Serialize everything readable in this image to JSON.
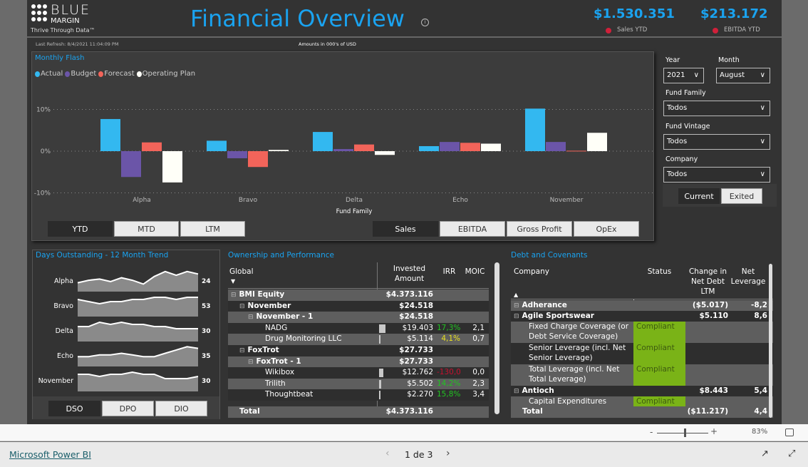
{
  "header": {
    "logo_line1": "BLUE",
    "logo_line2": "MARGIN",
    "logo_tag": "Thrive Through Data™",
    "title": "Financial Overview",
    "last_refresh": "Last Refresh: 8/4/2021 11:04:09 PM",
    "amounts_note": "Amounts in 000's of USD",
    "kpis": [
      {
        "value": "$1.530.351",
        "label": "Sales YTD",
        "status_color": "#d0203a"
      },
      {
        "value": "$213.172",
        "label": "EBITDA YTD",
        "status_color": "#d0203a"
      }
    ]
  },
  "monthly_flash": {
    "title": "Monthly Flash",
    "period_buttons": [
      {
        "label": "YTD",
        "selected": true
      },
      {
        "label": "MTD",
        "selected": false
      },
      {
        "label": "LTM",
        "selected": false
      }
    ],
    "metric_buttons": [
      {
        "label": "Sales",
        "selected": true
      },
      {
        "label": "EBITDA",
        "selected": false
      },
      {
        "label": "Gross Profit",
        "selected": false
      },
      {
        "label": "OpEx",
        "selected": false
      }
    ]
  },
  "chart_data": {
    "type": "bar",
    "title": "",
    "xlabel": "Fund Family",
    "ylabel": "",
    "categories": [
      "Alpha",
      "Bravo",
      "Delta",
      "Echo",
      "November"
    ],
    "ylim": [
      -10,
      10
    ],
    "yticks": [
      "10%",
      "0%",
      "-10%"
    ],
    "ytick_values": [
      10,
      0,
      -10
    ],
    "grid": true,
    "legend_position": "top-left",
    "series": [
      {
        "name": "Actual",
        "color": "#33b8f0",
        "values": [
          7.7,
          2.5,
          4.6,
          1.2,
          10.2
        ]
      },
      {
        "name": "Budget",
        "color": "#6b55a8",
        "values": [
          -6.2,
          -1.7,
          0.5,
          2.2,
          2.2
        ]
      },
      {
        "name": "Forecast",
        "color": "#f2645a",
        "values": [
          2.1,
          -3.8,
          1.6,
          2.0,
          0.1
        ]
      },
      {
        "name": "Operating Plan",
        "color": "#fffff8",
        "values": [
          -7.5,
          0.3,
          -0.9,
          1.8,
          4.4
        ]
      }
    ]
  },
  "days_outstanding": {
    "title": "Days Outstanding - 12 Month Trend",
    "rows": [
      {
        "label": "Alpha",
        "value": "24",
        "trend": [
          18,
          20,
          21,
          19,
          22,
          20,
          17,
          23,
          27,
          24,
          27,
          25
        ]
      },
      {
        "label": "Bravo",
        "value": "53",
        "trend": [
          52,
          51,
          50,
          51,
          51,
          52,
          52,
          53,
          53,
          52,
          53,
          53
        ]
      },
      {
        "label": "Delta",
        "value": "30",
        "trend": [
          31,
          31,
          33,
          32,
          33,
          32,
          32,
          31,
          31,
          30,
          30,
          30
        ]
      },
      {
        "label": "Echo",
        "value": "35",
        "trend": [
          30,
          30,
          31,
          31,
          32,
          31,
          30,
          30,
          32,
          34,
          36,
          35
        ]
      },
      {
        "label": "November",
        "value": "30",
        "trend": [
          32,
          32,
          31,
          32,
          32,
          33,
          32,
          32,
          30,
          30,
          30,
          31
        ]
      }
    ],
    "buttons": [
      {
        "label": "DSO",
        "selected": true
      },
      {
        "label": "DPO",
        "selected": false
      },
      {
        "label": "DIO",
        "selected": false
      }
    ]
  },
  "ownership": {
    "title": "Ownership and Performance",
    "columns": [
      "Global",
      "Invested Amount",
      "IRR",
      "MOIC"
    ],
    "rows": [
      {
        "name": "BMI Equity",
        "level": 0,
        "bold": true,
        "expand": true,
        "invested": "$4.373.116",
        "irr": "",
        "moic": ""
      },
      {
        "name": "November",
        "level": 1,
        "bold": true,
        "expand": true,
        "invested": "$24.518",
        "irr": "",
        "moic": ""
      },
      {
        "name": "November - 1",
        "level": 2,
        "bold": true,
        "expand": true,
        "invested": "$24.518",
        "irr": "",
        "moic": ""
      },
      {
        "name": "NADG",
        "level": 3,
        "invested": "$19.403",
        "irr": "17,3%",
        "irr_color": "#22c322",
        "moic": "2,1",
        "bar": 0.9
      },
      {
        "name": "Drug Monitoring LLC",
        "level": 3,
        "invested": "$5.114",
        "irr": "4,1%",
        "irr_color": "#e8e020",
        "moic": "0,7",
        "bar": 0.2
      },
      {
        "name": "FoxTrot",
        "level": 1,
        "bold": true,
        "expand": true,
        "invested": "$27.733",
        "irr": "",
        "moic": ""
      },
      {
        "name": "FoxTrot - 1",
        "level": 2,
        "bold": true,
        "expand": true,
        "invested": "$27.733",
        "irr": "",
        "moic": ""
      },
      {
        "name": "Wikibox",
        "level": 3,
        "invested": "$12.762",
        "irr": "-130,0%",
        "irr_color": "#c8102e",
        "moic": "0,0",
        "bar": 0.6
      },
      {
        "name": "Trilith",
        "level": 3,
        "invested": "$5.502",
        "irr": "14,2%",
        "irr_color": "#22c322",
        "moic": "2,3",
        "bar": 0.25
      },
      {
        "name": "Thoughtbeat",
        "level": 3,
        "invested": "$2.270",
        "irr": "15,8%",
        "irr_color": "#22c322",
        "moic": "3,4",
        "bar": 0.1
      }
    ],
    "total": {
      "label": "Total",
      "invested": "$4.373.116"
    }
  },
  "debt": {
    "title": "Debt and Covenants",
    "columns": [
      "Company",
      "Status",
      "Change in Net Debt LTM",
      "Net Leverage"
    ],
    "rows": [
      {
        "name": "Adherance",
        "bold": true,
        "expand": true,
        "status": "",
        "change": "($5.017)",
        "lev": "-8,2",
        "lines": 1
      },
      {
        "name": "Agile Sportswear",
        "bold": true,
        "expand": true,
        "status": "",
        "change": "$5.110",
        "lev": "8,6",
        "lines": 1
      },
      {
        "name": "Fixed Charge Coverage (or Debt Service Coverage)",
        "status": "Compliant",
        "change": "",
        "lev": "",
        "lines": 2
      },
      {
        "name": "Senior Leverage (incl. Net Senior Leverage)",
        "status": "Compliant",
        "change": "",
        "lev": "",
        "lines": 2
      },
      {
        "name": "Total Leverage (incl. Net Total Leverage)",
        "status": "Compliant",
        "change": "",
        "lev": "",
        "lines": 2
      },
      {
        "name": "Antioch",
        "bold": true,
        "expand": true,
        "status": "",
        "change": "$8.443",
        "lev": "5,4",
        "lines": 1
      },
      {
        "name": "Capital Expenditures",
        "status": "Compliant",
        "change": "",
        "lev": "",
        "lines": 1
      }
    ],
    "total": {
      "label": "Total",
      "change": "($11.217)",
      "lev": "4,4"
    },
    "compliant_color": "#7ab317"
  },
  "filters": {
    "year_label": "Year",
    "year_value": "2021",
    "month_label": "Month",
    "month_value": "August",
    "fund_family_label": "Fund Family",
    "fund_family_value": "Todos",
    "fund_vintage_label": "Fund Vintage",
    "fund_vintage_value": "Todos",
    "company_label": "Company",
    "company_value": "Todos",
    "toggle": [
      {
        "label": "Current",
        "selected": true
      },
      {
        "label": "Exited",
        "selected": false
      }
    ]
  },
  "footer": {
    "zoom": "83%",
    "brand_link": "Microsoft Power BI",
    "page_indicator": "1 de 3"
  }
}
